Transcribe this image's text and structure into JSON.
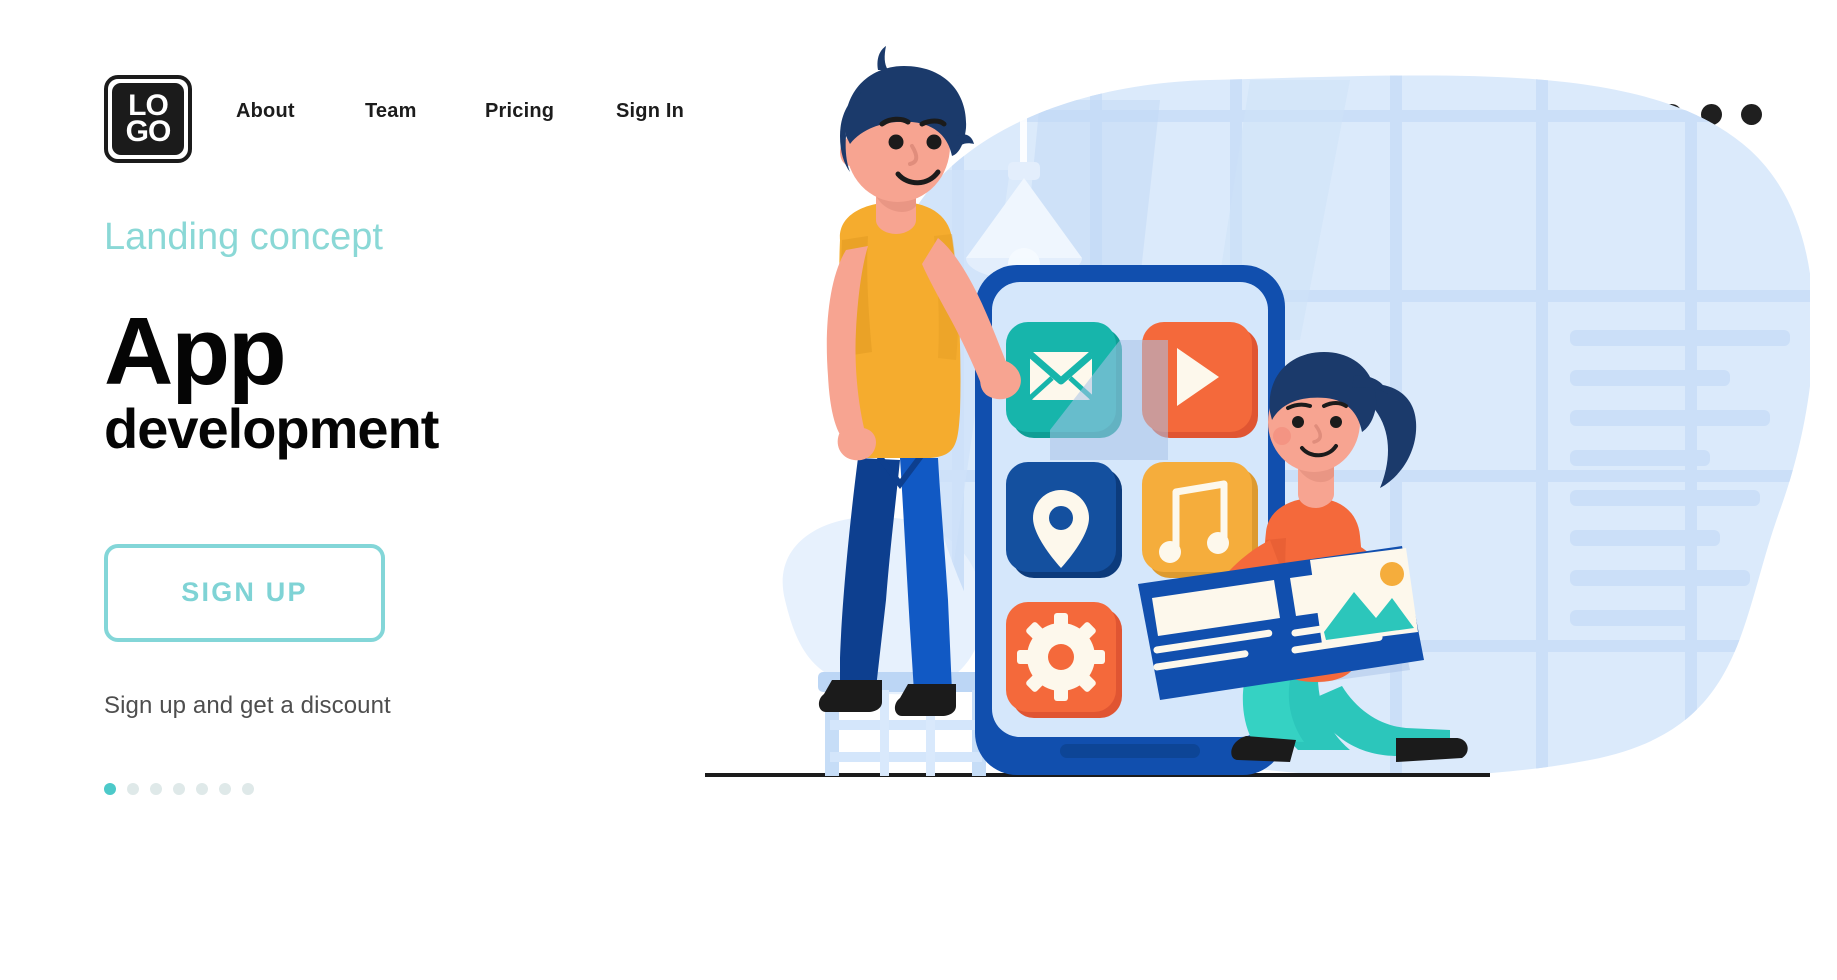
{
  "header": {
    "logo": {
      "line1": "LO",
      "line2": "GO",
      "name": "LOGO"
    },
    "nav": [
      {
        "label": "About"
      },
      {
        "label": "Team"
      },
      {
        "label": "Pricing"
      },
      {
        "label": "Sign In"
      }
    ],
    "menu_icon": "more-horizontal-icon"
  },
  "hero": {
    "eyebrow": "Landing concept",
    "title_main": "App",
    "title_sub": "development",
    "cta_label": "SIGN UP",
    "sub_note": "Sign up and get a discount",
    "dots_total": 7,
    "dots_active_index": 0
  },
  "colors": {
    "accent_teal": "#83d6d8",
    "eyebrow_teal": "#8ad8d6",
    "dot_active": "#4cc9c9",
    "dot_inactive": "#dfe9e9",
    "text_dark": "#050505",
    "text_muted": "#4e4e4e",
    "logo_black": "#1b1b1b",
    "blob_blue": "#dbeafb",
    "phone_blue": "#114fae",
    "phone_screen": "#d5e7fb",
    "icon_email_teal": "#17b5ab",
    "icon_play_orange": "#f4693b",
    "icon_location_blue": "#14509f",
    "icon_music_yellow": "#f5ad3c",
    "icon_gear_orange": "#f4693b",
    "shirt_yellow": "#f5ac2e",
    "jeans_blue": "#1159c4",
    "skin": "#f7a491",
    "hair_navy": "#1b3a6b",
    "woman_top_orange": "#f4693b",
    "woman_pants_teal": "#2cc6bb"
  },
  "illustration": {
    "name": "app-development-illustration",
    "app_icons": [
      {
        "name": "email-app-icon"
      },
      {
        "name": "play-app-icon"
      },
      {
        "name": "location-app-icon"
      },
      {
        "name": "music-app-icon"
      },
      {
        "name": "settings-gear-app-icon"
      }
    ],
    "characters": [
      {
        "name": "man-on-ladder-holding-email-icon"
      },
      {
        "name": "woman-kneeling-holding-card"
      }
    ],
    "objects": [
      {
        "name": "smartphone-device"
      },
      {
        "name": "step-ladder"
      },
      {
        "name": "pendant-lamp"
      },
      {
        "name": "window-grid-background"
      },
      {
        "name": "content-card"
      }
    ]
  }
}
